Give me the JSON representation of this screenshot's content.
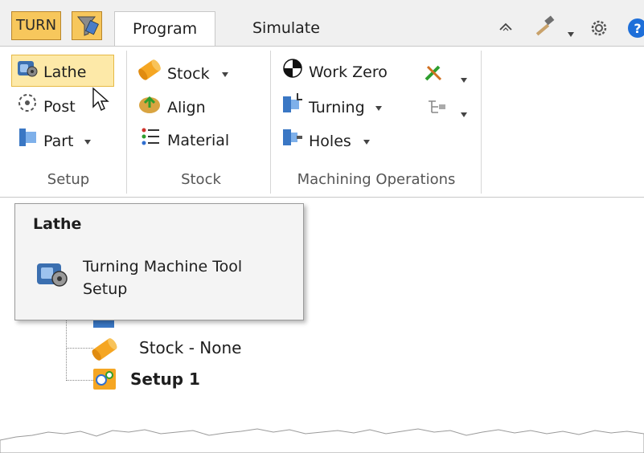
{
  "tabs": {
    "turn_label": "TURN",
    "funnel_icon": "funnel-tool-icon",
    "program_label": "Program",
    "simulate_label": "Simulate"
  },
  "quick_access": {
    "icons": [
      "collapse-ribbon-icon",
      "hammer-icon",
      "dropdown-arrow-icon",
      "gear-icon",
      "help-icon"
    ]
  },
  "ribbon": {
    "setup": {
      "label": "Setup",
      "lathe_label": "Lathe",
      "post_label": "Post",
      "part_label": "Part"
    },
    "stock": {
      "label": "Stock",
      "stock_label": "Stock",
      "align_label": "Align",
      "material_label": "Material"
    },
    "machining": {
      "label": "Machining Operations",
      "work_zero_label": "Work Zero",
      "turning_label": "Turning",
      "holes_label": "Holes"
    }
  },
  "tooltip": {
    "title": "Lathe",
    "description": "Turning Machine Tool Setup"
  },
  "tree": {
    "stock_item": "Stock - None",
    "setup_item": "Setup 1"
  },
  "colors": {
    "accent": "#f7c75c",
    "highlight": "#fde9a8",
    "help_blue": "#1e6fd9"
  }
}
